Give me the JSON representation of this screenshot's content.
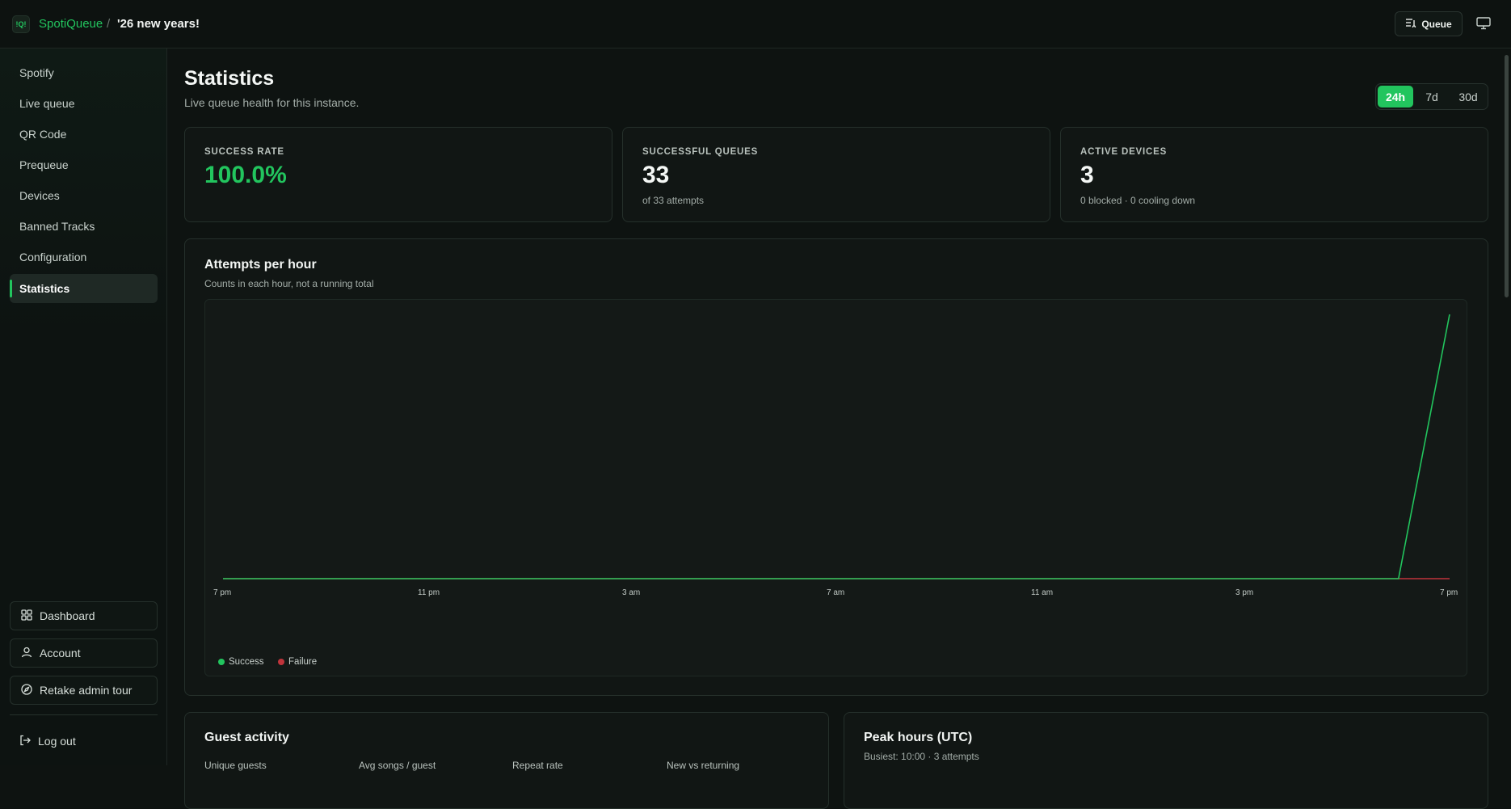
{
  "header": {
    "logo_glyph": "!Q!",
    "brand": "SpotiQueue",
    "separator": "/",
    "instance_title": "'26 new years!",
    "queue_label": "Queue"
  },
  "sidebar": {
    "items": [
      {
        "label": "Spotify"
      },
      {
        "label": "Live queue"
      },
      {
        "label": "QR Code"
      },
      {
        "label": "Prequeue"
      },
      {
        "label": "Devices"
      },
      {
        "label": "Banned Tracks"
      },
      {
        "label": "Configuration"
      },
      {
        "label": "Statistics",
        "active": true
      }
    ],
    "footer": {
      "dashboard": "Dashboard",
      "account": "Account",
      "retake_tour": "Retake admin tour",
      "logout": "Log out"
    }
  },
  "page": {
    "title": "Statistics",
    "subtitle": "Live queue health for this instance.",
    "ranges": [
      "24h",
      "7d",
      "30d"
    ],
    "active_range": "24h"
  },
  "stats": {
    "success_rate": {
      "label": "SUCCESS RATE",
      "value": "100.0%"
    },
    "successful_queues": {
      "label": "SUCCESSFUL QUEUES",
      "value": "33",
      "sub": "of 33 attempts"
    },
    "active_devices": {
      "label": "ACTIVE DEVICES",
      "value": "3",
      "sub": "0 blocked · 0 cooling down"
    }
  },
  "attempts_chart": {
    "title": "Attempts per hour",
    "subtitle": "Counts in each hour, not a running total"
  },
  "chart_data": {
    "type": "line",
    "title": "Attempts per hour",
    "x_ticks": [
      "7 pm",
      "11 pm",
      "3 am",
      "7 am",
      "11 am",
      "3 pm",
      "7 pm"
    ],
    "x_count": 25,
    "ylim": [
      0,
      33
    ],
    "series": [
      {
        "name": "Success",
        "color": "#22c55e",
        "values": [
          0,
          0,
          0,
          0,
          0,
          0,
          0,
          0,
          0,
          0,
          0,
          0,
          0,
          0,
          0,
          0,
          0,
          0,
          0,
          0,
          0,
          0,
          0,
          0,
          33
        ]
      },
      {
        "name": "Failure",
        "color": "#c0343b",
        "values": [
          0,
          0,
          0,
          0,
          0,
          0,
          0,
          0,
          0,
          0,
          0,
          0,
          0,
          0,
          0,
          0,
          0,
          0,
          0,
          0,
          0,
          0,
          0,
          0,
          0
        ]
      }
    ],
    "grid": false,
    "legend": "bottom-left"
  },
  "guest_activity": {
    "title": "Guest activity",
    "labels": [
      "Unique guests",
      "Avg songs / guest",
      "Repeat rate",
      "New vs returning"
    ]
  },
  "peak_hours": {
    "title": "Peak hours (UTC)",
    "subtitle": "Busiest: 10:00 · 3 attempts"
  }
}
